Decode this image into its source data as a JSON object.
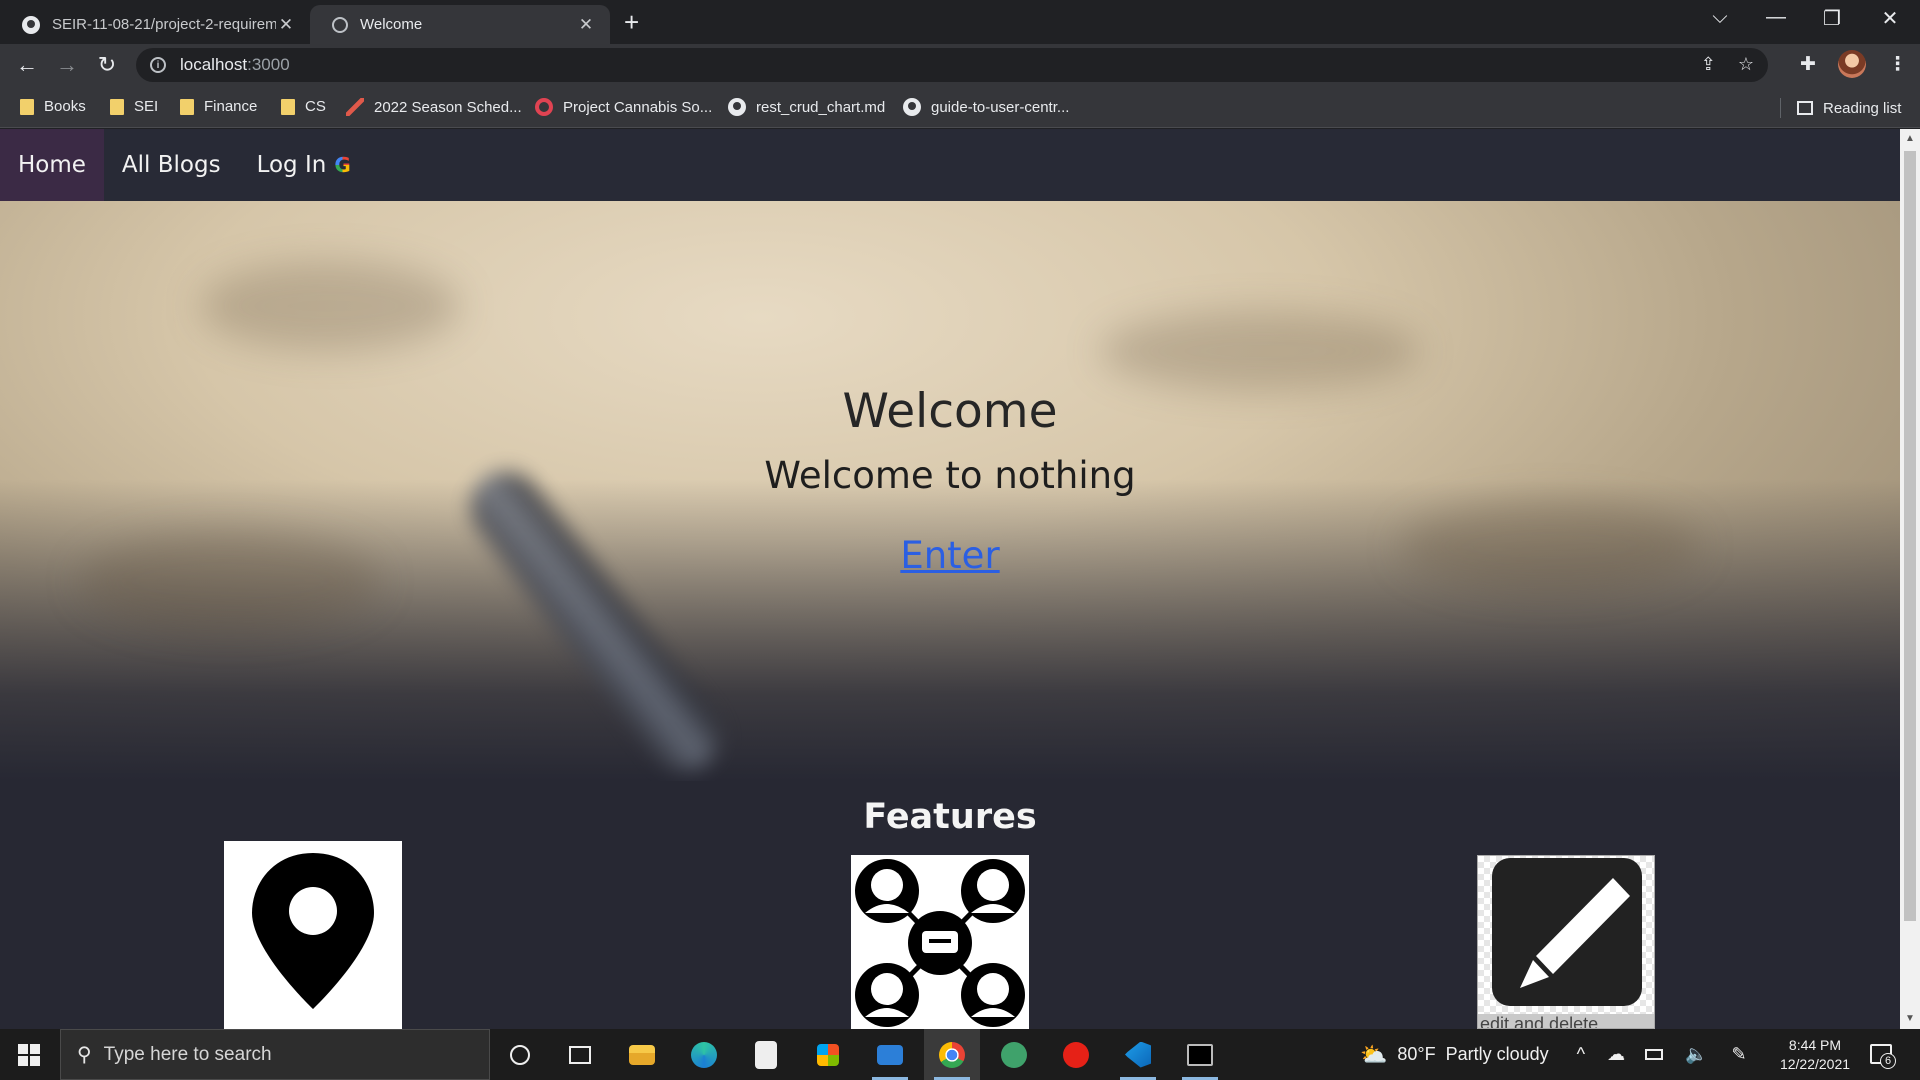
{
  "browser": {
    "tabs": [
      {
        "title": "SEIR-11-08-21/project-2-requirements",
        "icon": "github-icon"
      },
      {
        "title": "Welcome",
        "icon": "globe-icon"
      }
    ],
    "new_tab_glyph": "+",
    "window_controls": {
      "tab_search": "⌵",
      "minimize": "—",
      "restore": "❐",
      "close": "✕"
    },
    "url": {
      "host": "localhost",
      "port": ":3000"
    },
    "bookmarks": [
      {
        "label": "Books",
        "icon": "folder-icon"
      },
      {
        "label": "SEI",
        "icon": "folder-icon"
      },
      {
        "label": "Finance",
        "icon": "folder-icon"
      },
      {
        "label": "CS",
        "icon": "folder-icon"
      },
      {
        "label": "2022 Season Sched...",
        "icon": "mlb-icon"
      },
      {
        "label": "Project Cannabis So...",
        "icon": "cannabis-icon"
      },
      {
        "label": "rest_crud_chart.md",
        "icon": "github-icon"
      },
      {
        "label": "guide-to-user-centr...",
        "icon": "github-icon"
      }
    ],
    "reading_list": "Reading list"
  },
  "site": {
    "nav": {
      "home": "Home",
      "all_blogs": "All Blogs",
      "log_in": "Log In",
      "google_glyph": "G"
    },
    "hero": {
      "title": "Welcome",
      "subtitle": "Welcome to nothing",
      "enter_link": "Enter"
    },
    "features": {
      "title": "Features",
      "items": [
        {
          "icon": "location-pin-icon"
        },
        {
          "icon": "community-chat-icon"
        },
        {
          "icon": "edit-pencil-icon",
          "caption": "edit and delete"
        }
      ]
    }
  },
  "taskbar": {
    "search_placeholder": "Type here to search",
    "weather": {
      "temp": "80°F",
      "condition": "Partly cloudy"
    },
    "clock": {
      "time": "8:44 PM",
      "date": "12/22/2021"
    },
    "notification_count": "6"
  }
}
